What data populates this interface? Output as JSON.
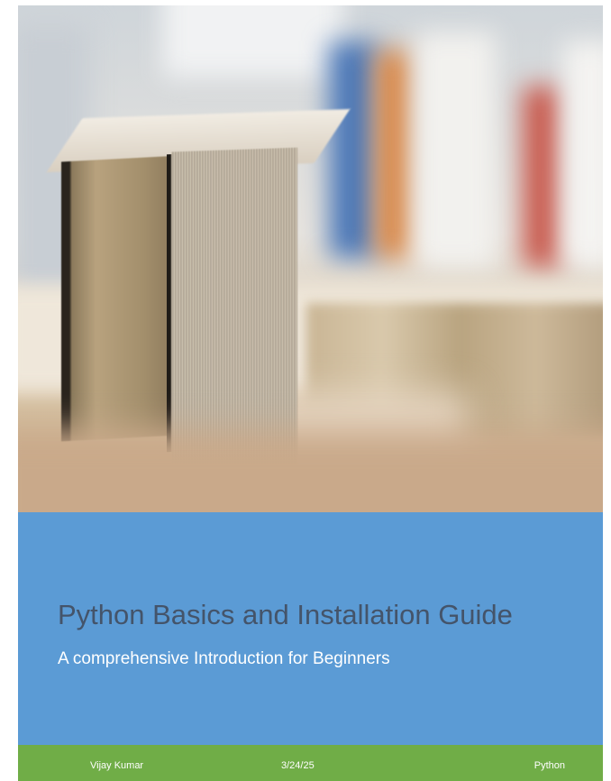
{
  "cover": {
    "title": "Python Basics and Installation Guide",
    "subtitle": "A comprehensive Introduction for Beginners",
    "image_icon": "books-on-shelf-photo",
    "colors": {
      "title_band": "#5b9bd5",
      "footer_band": "#70ad47",
      "title_text": "#44546a",
      "subtitle_text": "#ffffff"
    }
  },
  "footer": {
    "author": "Vijay Kumar",
    "date": "3/24/25",
    "subject": "Python"
  }
}
